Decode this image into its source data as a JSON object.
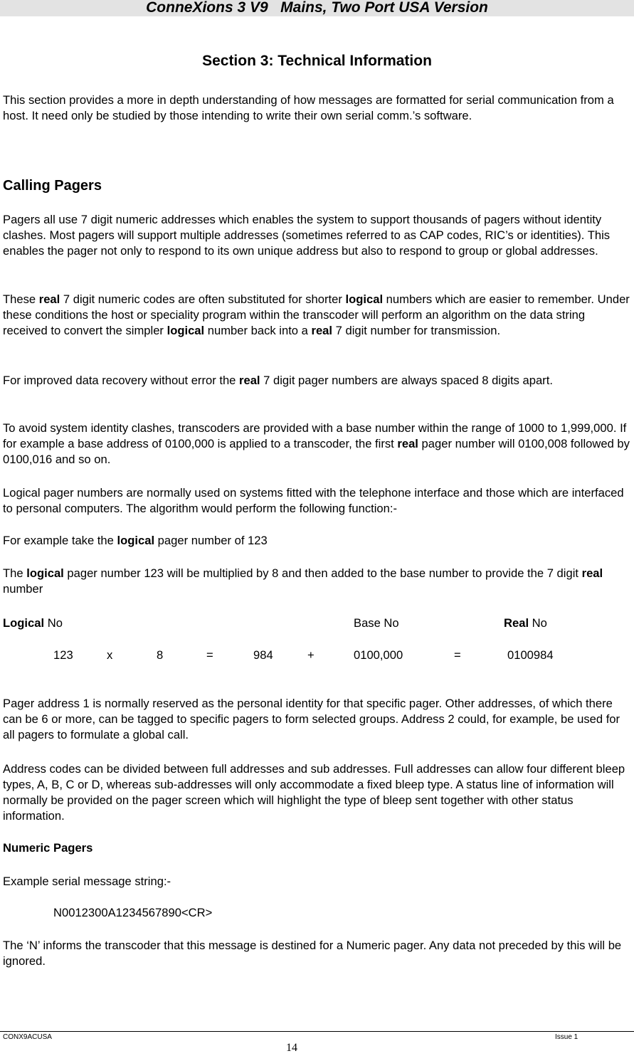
{
  "header": {
    "title": "ConneXions 3 V9   Mains, Two Port USA Version"
  },
  "section_title": "Section 3: Technical Information",
  "intro": "This section provides a more in depth understanding of how messages are formatted for serial communication from a host. It need only be studied by those intending to write their own serial comm.’s software.",
  "calling_pagers": {
    "heading": "Calling Pagers",
    "p1": "Pagers all use 7 digit numeric addresses which enables the system to support thousands of pagers without identity clashes. Most pagers will support multiple addresses (sometimes referred to as CAP codes, RIC’s or identities). This enables the pager not only to respond to its own unique address but also to respond to group or global addresses.",
    "p2": {
      "a": "These ",
      "b1": "real",
      "c": " 7 digit numeric codes are often substituted for shorter ",
      "b2": "logical",
      "d": " numbers which are easier to remember. Under these conditions the host or speciality program within the transcoder will perform an algorithm on the data string received to convert the simpler ",
      "b3": "logical",
      "e": " number back into a ",
      "b4": "real",
      "f": " 7 digit number for transmission."
    },
    "p3": {
      "a": "For improved data recovery without error the ",
      "b1": "real",
      "c": " 7 digit pager numbers are always spaced 8 digits apart."
    },
    "p4": {
      "a": "To avoid system identity clashes, transcoders are provided with a base number within the range of 1000 to 1,999,000.  If for example a base address of 0100,000 is applied to a transcoder, the first ",
      "b1": "real",
      "c": " pager number will 0100,008 followed by 0100,016 and so on."
    },
    "p5": "Logical pager numbers are normally used on systems fitted with the telephone interface and those which are interfaced to personal computers. The algorithm would perform the following function:-",
    "p6": {
      "a": "For example take the ",
      "b1": "logical",
      "c": " pager number of 123"
    },
    "p7": {
      "a": "The ",
      "b1": "logical",
      "c": " pager number 123 will be multiplied by 8 and then added to the base number to provide the 7 digit ",
      "b2": "real",
      "d": " number"
    }
  },
  "calculation": {
    "headers": {
      "logical_bold": "Logical",
      "logical_rest": " No",
      "base": "Base No",
      "real_bold": "Real",
      "real_rest": " No"
    },
    "row": [
      "123",
      "x",
      "8",
      "=",
      "984",
      "+",
      "0100,000",
      "=",
      "0100984"
    ]
  },
  "p8": "Pager address 1 is normally reserved as the personal identity for that specific pager.  Other addresses, of which there can be 6 or more, can be tagged to specific pagers to form selected groups.  Address 2 could, for example, be used for all pagers to formulate a global call.",
  "p9": "Address codes can be divided between full addresses and sub addresses. Full addresses can allow four different bleep types, A, B, C or D, whereas sub-addresses will only accommodate a fixed bleep type. A status line of information will normally be provided on the pager screen which will highlight the type of bleep sent together with other status information.",
  "numeric_pagers": {
    "heading": "Numeric Pagers",
    "example_label": "Example serial message string:-",
    "example_string": "N0012300A1234567890<CR>",
    "p1": "The ‘N’ informs the transcoder that this message is destined for a Numeric pager.  Any data not preceded by this will be ignored."
  },
  "footer": {
    "doc_code": "CONX9ACUSA",
    "issue": "Issue 1",
    "page_number": "14"
  }
}
